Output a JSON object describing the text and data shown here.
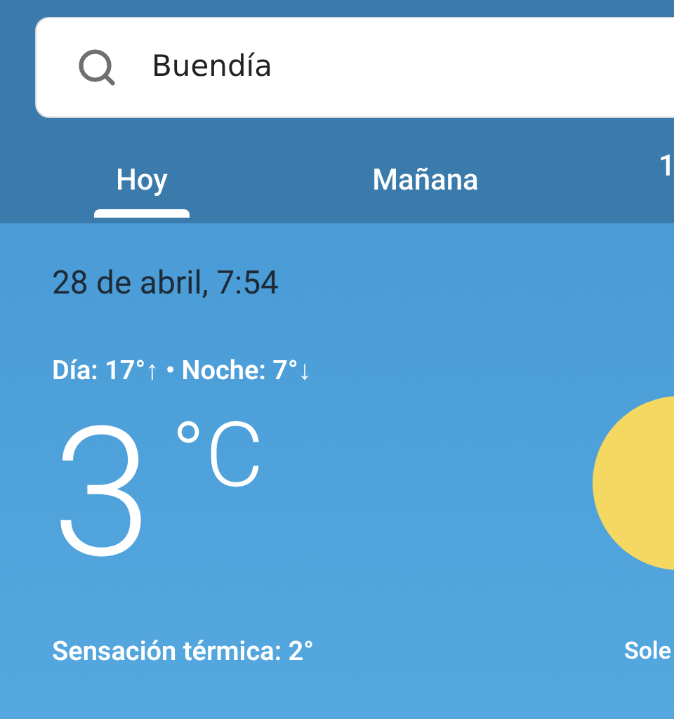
{
  "search": {
    "value": "Buendía"
  },
  "tabs": [
    {
      "label": "Hoy",
      "selected": true
    },
    {
      "label": "Mañana",
      "selected": false
    },
    {
      "label": "1",
      "selected": false
    }
  ],
  "weather": {
    "datetime": "28 de abril, 7:54",
    "high_low": "Día: 17°↑ • Noche: 7°↓",
    "temperature": "3",
    "unit": "°C",
    "feels_like": "Sensación térmica: 2°",
    "condition": "Sole"
  }
}
